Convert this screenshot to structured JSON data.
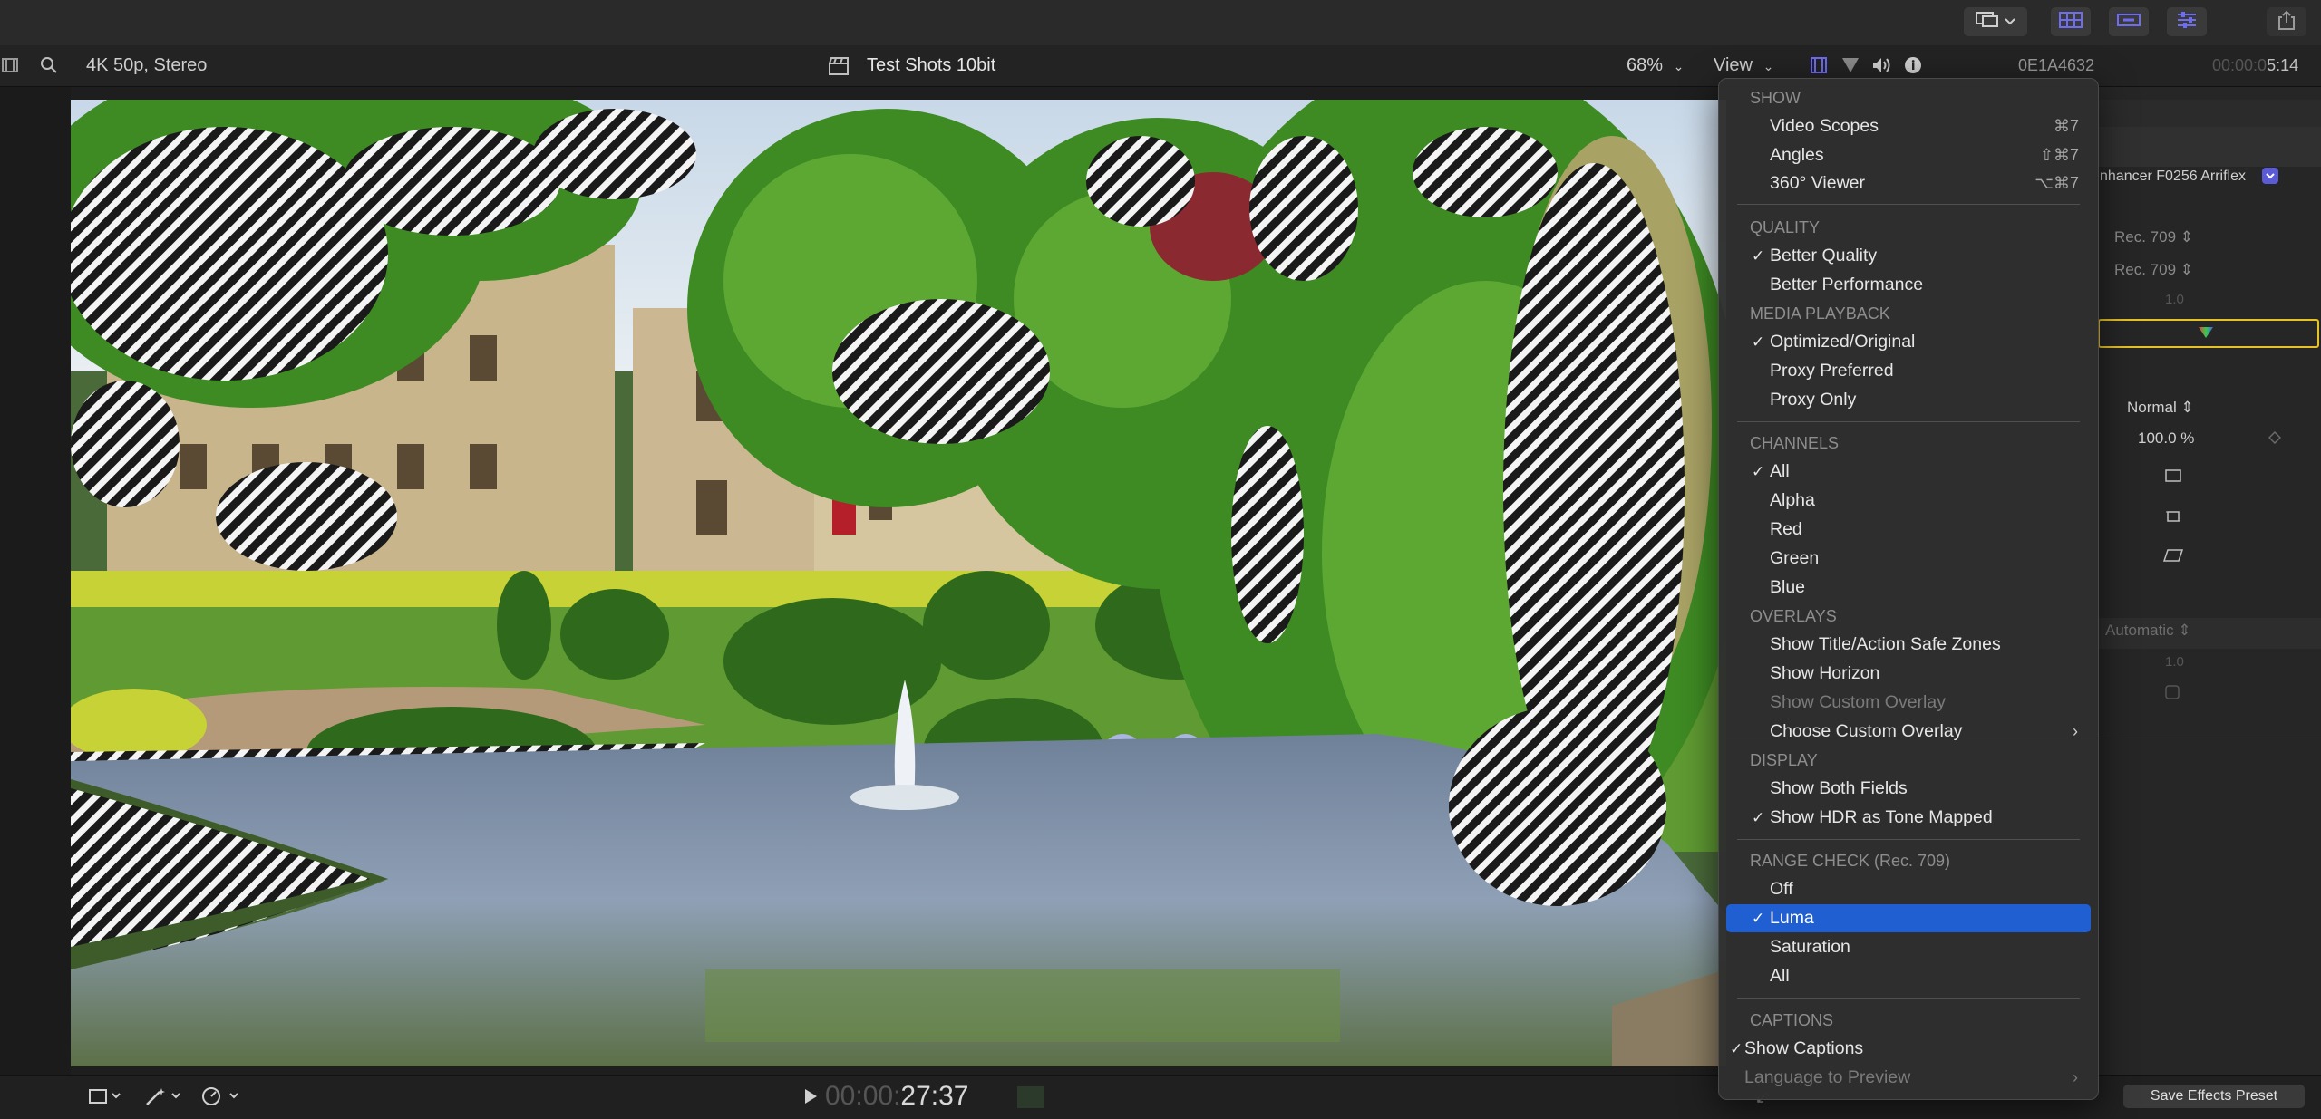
{
  "viewer": {
    "format": "4K 50p, Stereo",
    "project_title": "Test Shots 10bit",
    "zoom": "68%",
    "view_button": "View",
    "timecode_dim": "00:00:",
    "timecode_main": "27:37"
  },
  "inspector": {
    "clip_id": "0E1A4632",
    "timecode_dim": "00:00:0",
    "timecode_main": "5:14",
    "effect_name": "nhancer F0256 Arriflex",
    "rec_a": "Rec. 709",
    "rec_b": "Rec. 709",
    "value_a": "1.0",
    "blend_mode": "Normal",
    "opacity_value": "100.0",
    "opacity_unit": "%",
    "auto_label": "Automatic",
    "value_b": "1.0",
    "save_preset": "Save Effects Preset"
  },
  "menu": {
    "show_header": "SHOW",
    "video_scopes": "Video Scopes",
    "video_scopes_sc": "⌘7",
    "angles": "Angles",
    "angles_sc": "⇧⌘7",
    "viewer360": "360° Viewer",
    "viewer360_sc": "⌥⌘7",
    "quality_header": "QUALITY",
    "better_quality": "Better Quality",
    "better_performance": "Better Performance",
    "media_header": "MEDIA PLAYBACK",
    "optimized": "Optimized/Original",
    "proxy_preferred": "Proxy Preferred",
    "proxy_only": "Proxy Only",
    "channels_header": "CHANNELS",
    "ch_all": "All",
    "ch_alpha": "Alpha",
    "ch_red": "Red",
    "ch_green": "Green",
    "ch_blue": "Blue",
    "overlays_header": "OVERLAYS",
    "safe_zones": "Show Title/Action Safe Zones",
    "horizon": "Show Horizon",
    "custom_overlay": "Show Custom Overlay",
    "choose_overlay": "Choose Custom Overlay",
    "display_header": "DISPLAY",
    "both_fields": "Show Both Fields",
    "hdr_tone": "Show HDR as Tone Mapped",
    "range_header": "RANGE CHECK (Rec. 709)",
    "rc_off": "Off",
    "rc_luma": "Luma",
    "rc_saturation": "Saturation",
    "rc_all": "All",
    "captions_header": "CAPTIONS",
    "show_captions": "Show Captions",
    "language_preview": "Language to Preview",
    "checkmark": "✓",
    "submenu_arrow": "›"
  },
  "colors": {
    "accent": "#1f5fd1",
    "tool_purple": "#6e6cf0",
    "highlight_yellow": "#e6c229"
  }
}
